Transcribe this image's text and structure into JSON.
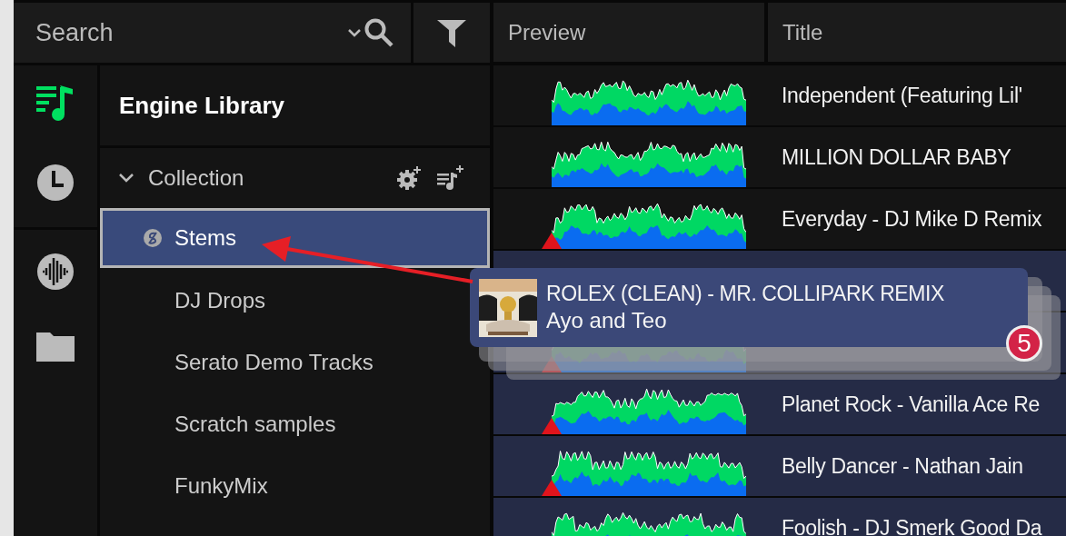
{
  "search": {
    "placeholder": "Search"
  },
  "nav": [
    {
      "kind": "library",
      "selected": true
    },
    {
      "kind": "history",
      "selected": false
    },
    {
      "kind": "stems",
      "selected": false
    },
    {
      "kind": "folder",
      "selected": false
    }
  ],
  "sidebar": {
    "title": "Engine Library",
    "collection": {
      "label": "Collection",
      "expanded": true
    },
    "items": [
      {
        "label": "Stems",
        "kind": "stems",
        "selected": true
      },
      {
        "label": "DJ Drops",
        "kind": "playlist",
        "selected": false
      },
      {
        "label": "Serato Demo Tracks",
        "kind": "playlist",
        "selected": false
      },
      {
        "label": "Scratch samples",
        "kind": "playlist",
        "selected": false
      },
      {
        "label": "FunkyMix",
        "kind": "playlist",
        "selected": false
      }
    ]
  },
  "table": {
    "columns": [
      "Preview",
      "Title"
    ],
    "rows": [
      {
        "title": "Independent (Featuring Lil'",
        "selected": false,
        "marker": false,
        "waveform": true
      },
      {
        "title": "MILLION DOLLAR BABY",
        "selected": false,
        "marker": false,
        "waveform": true
      },
      {
        "title": "Everyday - DJ Mike D Remix",
        "selected": false,
        "marker": true,
        "waveform": true
      },
      {
        "selected": true,
        "marker": false,
        "waveform": false
      },
      {
        "selected": true,
        "marker": true,
        "waveform": true
      },
      {
        "title": "Planet Rock - Vanilla Ace Re",
        "selected": true,
        "marker": true,
        "waveform": true
      },
      {
        "title": "Belly Dancer - Nathan Jain",
        "selected": true,
        "marker": true,
        "waveform": true
      },
      {
        "title": "Foolish - DJ Smerk Good Da",
        "selected": true,
        "marker": false,
        "waveform": true
      }
    ]
  },
  "drag": {
    "title": "ROLEX (CLEAN) - MR. COLLIPARK REMIX",
    "artist": "Ayo and Teo",
    "count": "5"
  }
}
